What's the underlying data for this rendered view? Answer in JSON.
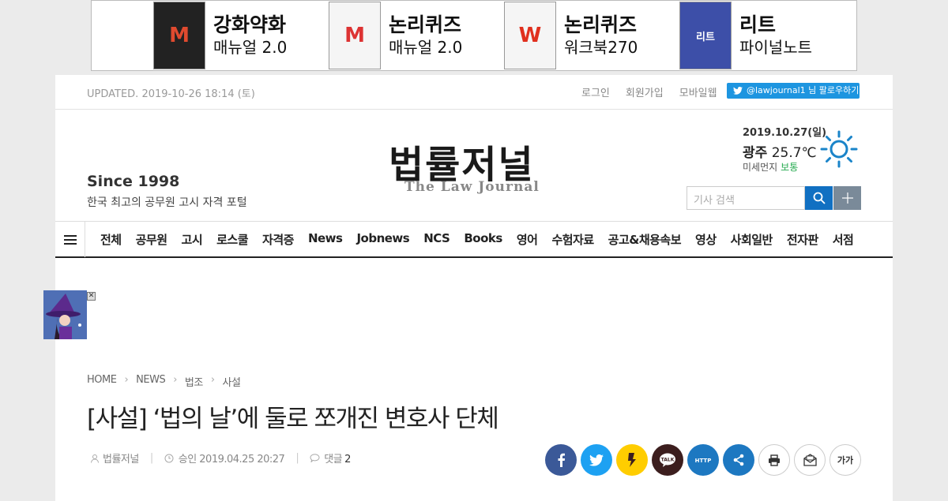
{
  "banner": {
    "items": [
      {
        "book": "M",
        "title": "강화약화",
        "sub": "매뉴얼 2.0",
        "style": "dark"
      },
      {
        "book": "M",
        "title": "논리퀴즈",
        "sub": "매뉴얼 2.0",
        "style": "light"
      },
      {
        "book": "W",
        "title": "논리퀴즈",
        "sub": "워크북270",
        "style": "light"
      },
      {
        "book": "리트",
        "title": "리트",
        "sub": "파이널노트",
        "style": "blue"
      }
    ]
  },
  "topbar": {
    "updated": "UPDATED. 2019-10-26 18:14 (토)",
    "links": [
      "로그인",
      "회원가입",
      "모바일웹"
    ],
    "twitter": "@lawjournal1 님 팔로우하기"
  },
  "masthead": {
    "since": "Since 1998",
    "slogan": "한국 최고의 공무원 고시 자격 포털",
    "logo_ko": "법률저널",
    "logo_en": "The Law Journal"
  },
  "weather": {
    "date": "2019.10.27(일)",
    "city": "광주",
    "temp": "25.7℃",
    "dust_label": "미세먼지",
    "dust_value": "보통",
    "icon": "sun-icon"
  },
  "search": {
    "placeholder": "기사 검색"
  },
  "nav": {
    "items": [
      "전체",
      "공무원",
      "고시",
      "로스쿨",
      "자격증",
      "News",
      "Jobnews",
      "NCS",
      "Books",
      "영어",
      "수험자료",
      "공고&채용속보",
      "영상",
      "사회일반",
      "전자판",
      "서점"
    ]
  },
  "breadcrumb": [
    "HOME",
    "NEWS",
    "법조",
    "사설"
  ],
  "article": {
    "title": "[사설] ‘법의 날’에 둘로 쪼개진 변호사 단체",
    "author": "법률저널",
    "approved": "승인 2019.04.25 20:27",
    "comments_label": "댓글",
    "comments_count": "2"
  },
  "share": [
    {
      "name": "facebook",
      "color": "#3b5998",
      "glyph": "f"
    },
    {
      "name": "twitter",
      "color": "#1da1f2",
      "glyph": "t"
    },
    {
      "name": "kakaostory",
      "color": "#ffcd00",
      "glyph": "❜"
    },
    {
      "name": "kakaotalk",
      "color": "#3c1e1e",
      "glyph": "TALK"
    },
    {
      "name": "url",
      "color": "#1d78c1",
      "glyph": "HTTP"
    },
    {
      "name": "more-share",
      "color": "#1d78c1",
      "glyph": "share"
    }
  ],
  "tools": [
    "print",
    "email",
    "font-size"
  ],
  "tools_font_label": "가가"
}
